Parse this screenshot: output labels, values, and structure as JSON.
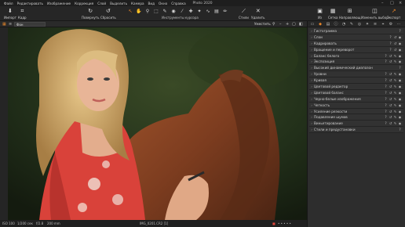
{
  "app": {
    "title": "Photo 2020"
  },
  "menu": [
    "Файл",
    "Редактировать",
    "Изображение",
    "Коррекция",
    "Слой",
    "Выделить",
    "Камера",
    "Вид",
    "Окно",
    "Справка"
  ],
  "toolbar": {
    "import": "Импорт",
    "crop": "Кадр",
    "rotate": "Повернуть",
    "reset": "Сбросить",
    "tools_group": "Инструменты курсора",
    "styles": "Стили",
    "delete": "Удалить",
    "right_buttons": [
      "Из",
      "Сетка",
      "Направляющ",
      "Изменить выбор",
      "Экспорт"
    ]
  },
  "options": {
    "layer_select": "Фон",
    "fit": "Уместить"
  },
  "status": {
    "iso": "ISO 100",
    "shutter": "1/200 сек",
    "aperture": "f/2.8",
    "focal": "200 mm",
    "filename": "IMG_0201.CR2 [1]"
  },
  "panel": {
    "items": [
      "Гистограмма",
      "Слои",
      "Кадрировать",
      "Вращение и переворот",
      "Баланс белого",
      "Экспозиция",
      "Высокий динамический диапазон",
      "Уровни",
      "Кривая",
      "Цветовой редактор",
      "Цветовой баланс",
      "Черно-белые изображения",
      "Четкость",
      "Усиление резкости",
      "Подавление шумов",
      "Виньетирование",
      "Стили и предустановки"
    ]
  },
  "colors": {
    "accent": "#e8862a",
    "bg": "#2b2b2b"
  }
}
